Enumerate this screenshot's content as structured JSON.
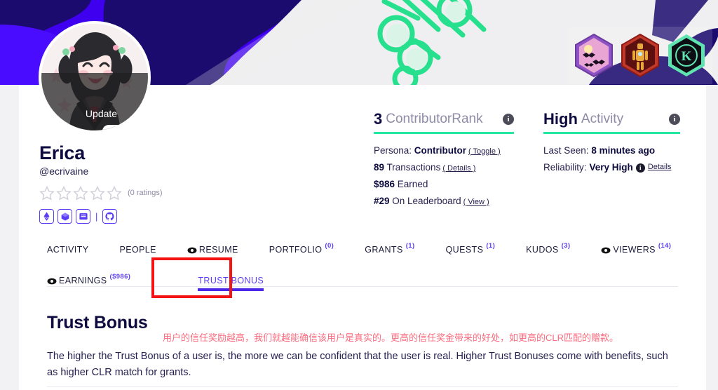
{
  "banner": {
    "colors": {
      "violet": "#4000f0",
      "navy": "#1b0b6e",
      "light": "#efeff1",
      "green": "#26e08e"
    },
    "badges": [
      {
        "name": "bats-badge",
        "title": "Bats Badge",
        "ring": "#9a5bd6",
        "fill": "#e9a6d4"
      },
      {
        "name": "ironman-badge",
        "title": "Ironman Badge",
        "ring": "#c0392b",
        "fill": "#6b1414"
      },
      {
        "name": "kudos-k-badge",
        "title": "Kudos K Badge",
        "ring": "#5fe3b0",
        "fill": "#101018",
        "letter": "K"
      }
    ]
  },
  "avatar": {
    "update_label": "Update",
    "alt": "profile-avatar"
  },
  "identity": {
    "name": "Erica",
    "handle": "@ecrivaine",
    "stars": 5,
    "ratings_text": "(0 ratings)",
    "separator": "|",
    "socials": [
      {
        "name": "eth-address-button",
        "icon": "ethereum-icon"
      },
      {
        "name": "package-button",
        "icon": "cube-icon"
      },
      {
        "name": "inbox-button",
        "icon": "inbox-icon"
      },
      {
        "name": "github-button",
        "icon": "github-icon"
      }
    ]
  },
  "rank_card": {
    "value": "3",
    "label": "ContributorRank",
    "info_icon": "info-icon",
    "lines": [
      {
        "prefix": "Persona: ",
        "bold": "Contributor",
        "suffix": "",
        "link": "( Toggle )"
      },
      {
        "prefix": "",
        "bold": "89",
        "suffix": " Transactions",
        "link": "( Details )"
      },
      {
        "prefix": "",
        "bold": "$986",
        "suffix": " Earned",
        "link": ""
      },
      {
        "prefix": "",
        "bold": "#29",
        "suffix": " On Leaderboard",
        "link": "( View )"
      }
    ]
  },
  "activity_card": {
    "value": "High",
    "label": "Activity",
    "info_icon": "info-icon",
    "lines": [
      {
        "prefix": "Last Seen: ",
        "bold": "8 minutes ago",
        "suffix": "",
        "link": ""
      },
      {
        "prefix": "Reliability: ",
        "bold": "Very High",
        "suffix": "",
        "link": "Details",
        "inline_info": true
      }
    ]
  },
  "tabs": {
    "row1": [
      {
        "label": "ACTIVITY",
        "sup": "",
        "icon": "",
        "active": false,
        "name": "tab-activity"
      },
      {
        "label": "PEOPLE",
        "sup": "",
        "icon": "",
        "active": false,
        "name": "tab-people"
      },
      {
        "label": "RESUME",
        "sup": "",
        "icon": "eye-icon",
        "active": false,
        "name": "tab-resume"
      },
      {
        "label": "PORTFOLIO",
        "sup": "(0)",
        "icon": "",
        "active": false,
        "name": "tab-portfolio"
      },
      {
        "label": "GRANTS",
        "sup": "(1)",
        "icon": "",
        "active": false,
        "name": "tab-grants"
      },
      {
        "label": "QUESTS",
        "sup": "(1)",
        "icon": "",
        "active": false,
        "name": "tab-quests"
      },
      {
        "label": "KUDOS",
        "sup": "(3)",
        "icon": "",
        "active": false,
        "name": "tab-kudos"
      },
      {
        "label": "VIEWERS",
        "sup": "(14)",
        "icon": "eye-icon",
        "active": false,
        "name": "tab-viewers"
      }
    ],
    "row2": [
      {
        "label": "EARNINGS",
        "sup": "($986)",
        "icon": "eye-icon",
        "active": false,
        "name": "tab-earnings"
      },
      {
        "label": "TRUST BONUS",
        "sup": "",
        "icon": "",
        "active": true,
        "name": "tab-trust-bonus"
      }
    ],
    "highlight_color": "#f51414"
  },
  "content": {
    "heading": "Trust Bonus",
    "note_cn": "用户的信任奖励越高，我们就越能确信该用户是真实的。更高的信任奖金带来的好处，如更高的CLR匹配的赠款。",
    "paragraph": "The higher the Trust Bonus of a user is, the more we can be confident that the user is real. Higher Trust Bonuses come with benefits, such as higher CLR match for grants."
  }
}
